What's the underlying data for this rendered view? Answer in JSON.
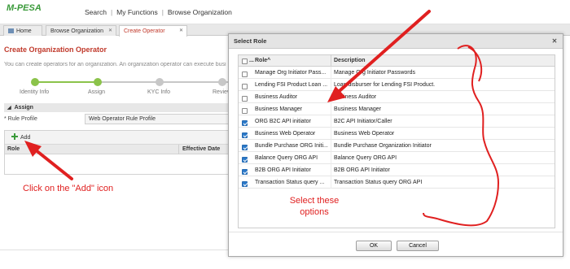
{
  "app": {
    "logo_text": "M-PESA"
  },
  "topnav": {
    "items": [
      "Search",
      "My Functions",
      "Browse Organization"
    ]
  },
  "tabs": [
    {
      "label": "Home"
    },
    {
      "label": "Browse Organization"
    },
    {
      "label": "Create Operator"
    }
  ],
  "page": {
    "title": "Create Organization Operator",
    "subtitle": "You can create operators for an organization. An organization operator can execute busi"
  },
  "stepper": {
    "steps": [
      {
        "label": "Identity Info",
        "state": "done"
      },
      {
        "label": "Assign",
        "state": "current"
      },
      {
        "label": "KYC Info",
        "state": "pending"
      },
      {
        "label": "Reviev",
        "state": "pending"
      }
    ],
    "done_color": "#8bc34a",
    "pending_color": "#c7c7c7"
  },
  "assign": {
    "section_label": "Assign",
    "rule_profile_label": "Rule Profile",
    "rule_profile_value": "Web Operator Rule Profile"
  },
  "grid": {
    "add_label": "Add",
    "columns": [
      "Role",
      "Effective Date"
    ]
  },
  "annotations": {
    "click": "Click on the \"Add\" icon",
    "select": "Select these options",
    "color": "#e02020"
  },
  "dialog": {
    "title": "Select Role",
    "close_icon": "close-icon",
    "header_dots": "...",
    "columns": [
      "Role",
      "Description"
    ],
    "rows": [
      {
        "role": "Manage Org Initiator Pass...",
        "desc": "Manage Org Initiator Passwords",
        "checked": false
      },
      {
        "role": "Lending FSI Product Loan ...",
        "desc": "Loan disburser for Lending FSI Product.",
        "checked": false
      },
      {
        "role": "Business Auditor",
        "desc": "Business Auditor",
        "checked": false
      },
      {
        "role": "Business Manager",
        "desc": "Business Manager",
        "checked": false
      },
      {
        "role": "ORG B2C API initiator",
        "desc": "B2C API Initiator/Caller",
        "checked": true
      },
      {
        "role": "Business Web Operator",
        "desc": "Business Web Operator",
        "checked": true
      },
      {
        "role": "Bundle Purchase ORG Initi...",
        "desc": "Bundle Purchase Organization Initiator",
        "checked": true
      },
      {
        "role": "Balance Query ORG API",
        "desc": "Balance Query ORG API",
        "checked": true
      },
      {
        "role": "B2B ORG API Initiator",
        "desc": "B2B ORG API Initiator",
        "checked": true
      },
      {
        "role": "Transaction Status query ...",
        "desc": "Transaction Status query ORG API",
        "checked": true
      }
    ],
    "ok_label": "OK",
    "cancel_label": "Cancel"
  }
}
